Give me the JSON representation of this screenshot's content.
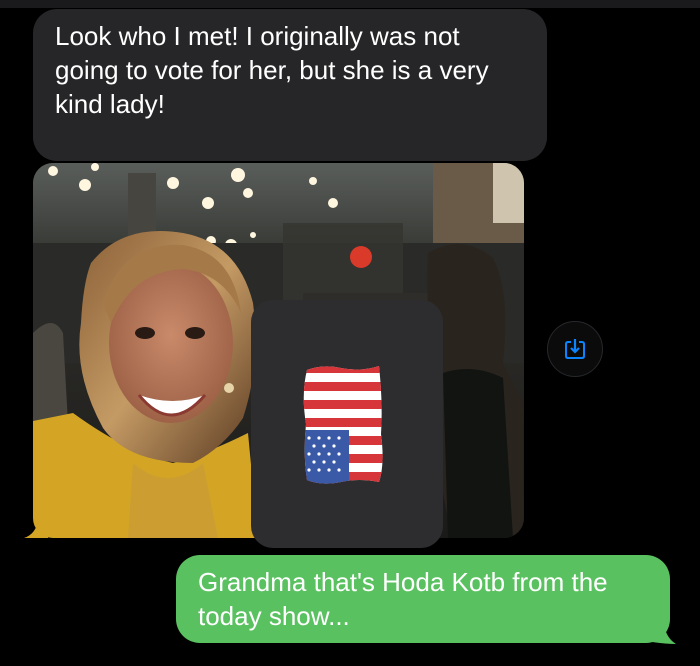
{
  "conversation": {
    "incoming": {
      "text": "Look who I met! I originally was not going to vote for her, but she is a very kind lady!",
      "color": "#262628"
    },
    "photo": {
      "subject": "Woman in yellow jacket smiling in a restaurant",
      "sticker": "american-flag-icon"
    },
    "save_button": {
      "icon": "download-icon",
      "color": "#0a84ff"
    },
    "outgoing": {
      "text": "Grandma that's Hoda Kotb from the today show...",
      "color": "#5ac160"
    }
  }
}
